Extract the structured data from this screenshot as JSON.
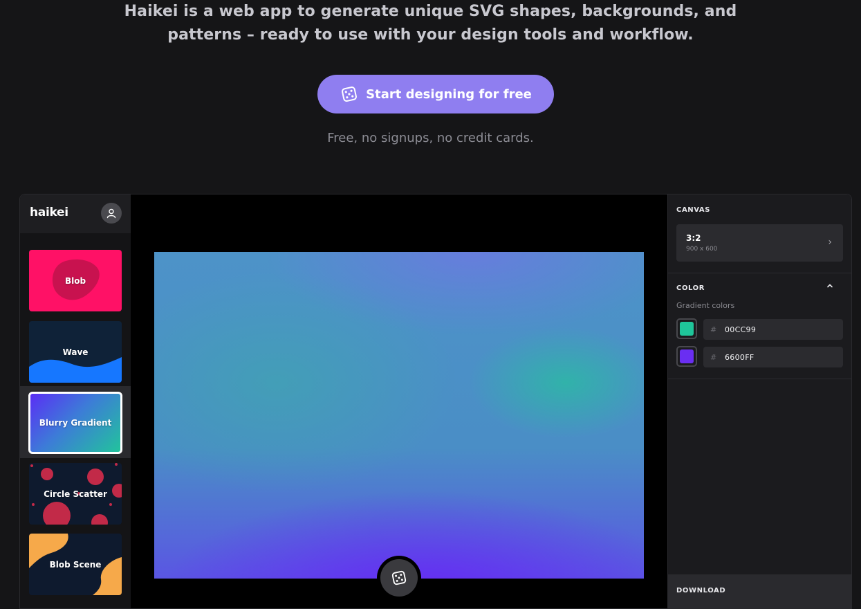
{
  "hero": {
    "line1": "Haikei is a web app to generate unique SVG shapes, backgrounds, and",
    "line2": "patterns – ready to use with your design tools and workflow.",
    "cta_label": "Start designing for free",
    "tagline": "Free, no signups, no credit cards."
  },
  "app": {
    "logo": "haikei",
    "generators": [
      {
        "label": "Blob",
        "icon": "blob"
      },
      {
        "label": "Wave",
        "icon": "wave"
      },
      {
        "label": "Blurry Gradient",
        "icon": "blurry-gradient",
        "selected": true
      },
      {
        "label": "Circle Scatter",
        "icon": "circle-scatter"
      },
      {
        "label": "Blob Scene",
        "icon": "blob-scene"
      }
    ],
    "panel": {
      "canvas_heading": "CANVAS",
      "canvas_ratio": "3:2",
      "canvas_dims": "900 x 600",
      "color_heading": "COLOR",
      "gradient_label": "Gradient colors",
      "colors": [
        {
          "hash": "#",
          "hex": "00CC99",
          "swatch": "#1fc59a"
        },
        {
          "hash": "#",
          "hex": "6600FF",
          "swatch": "#6a2ef2"
        }
      ],
      "download_heading": "DOWNLOAD"
    }
  },
  "colors": {
    "accent": "#8f7ef0",
    "blob_card": "#ff1166",
    "wave_card": "#0f2238"
  }
}
